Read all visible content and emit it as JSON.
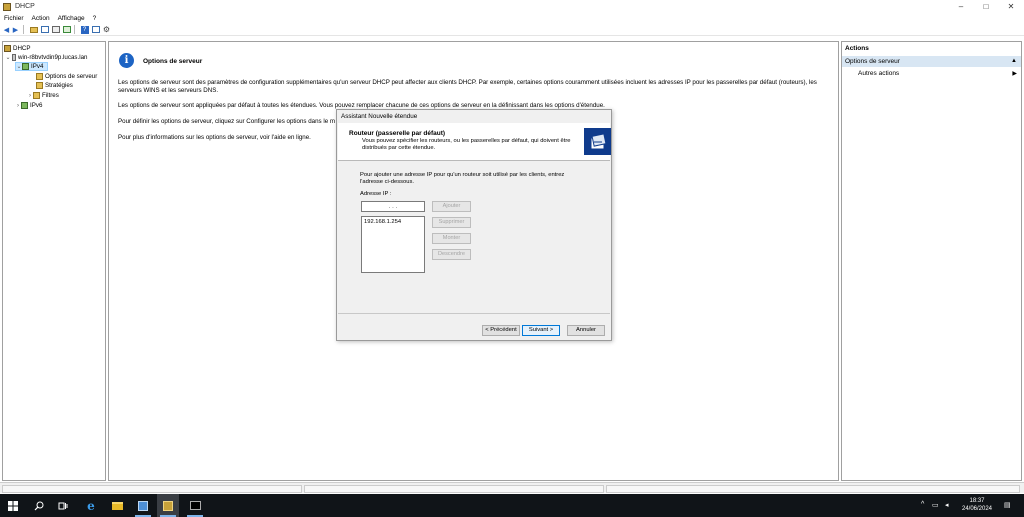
{
  "window": {
    "title": "DHCP",
    "controls": [
      "–",
      "□",
      "✕"
    ]
  },
  "menu": [
    "Fichier",
    "Action",
    "Affichage",
    "?"
  ],
  "tree": {
    "root": "DHCP",
    "server": "win-r8bvtvdin9p.lucas.lan",
    "ipv4": "IPv4",
    "server_options": "Options de serveur",
    "policies": "Stratégies",
    "filters": "Filtres",
    "ipv6": "IPv6"
  },
  "main": {
    "title": "Options de serveur",
    "p1": "Les options de serveur sont des paramètres de configuration supplémentaires qu'un serveur DHCP peut affecter aux clients DHCP. Par exemple, certaines options couramment utilisées incluent les adresses IP pour les passerelles par défaut (routeurs), les serveurs WINS et les serveurs DNS.",
    "p2": "Les options de serveur sont appliquées par défaut à toutes les étendues. Vous pouvez remplacer chacune de ces options de serveur en la définissant dans les options d'étendue.",
    "p3": "Pour définir les options de serveur, cliquez sur Configurer les options dans le m",
    "p4": "Pour plus d'informations sur les options de serveur, voir l'aide en ligne."
  },
  "actions": {
    "header": "Actions",
    "section": "Options de serveur",
    "item": "Autres actions"
  },
  "dialog": {
    "title": "Assistant Nouvelle étendue",
    "heading": "Routeur (passerelle par défaut)",
    "subheading": "Vous pouvez spécifier les routeurs, ou les passerelles par défaut, qui doivent être distribués par cette étendue.",
    "instruction": "Pour ajouter une adresse IP pour qu'un routeur soit utilisé par les clients, entrez l'adresse ci-dessous.",
    "ip_label": "Adresse IP :",
    "ip_value": ". . .",
    "list_items": [
      "192.168.1.254"
    ],
    "buttons": {
      "add": "Ajouter",
      "remove": "Supprimer",
      "up": "Monter",
      "down": "Descendre",
      "back": "< Précédent",
      "next": "Suivant >",
      "cancel": "Annuler"
    }
  },
  "taskbar": {
    "time": "18:37",
    "date": "24/06/2024"
  }
}
